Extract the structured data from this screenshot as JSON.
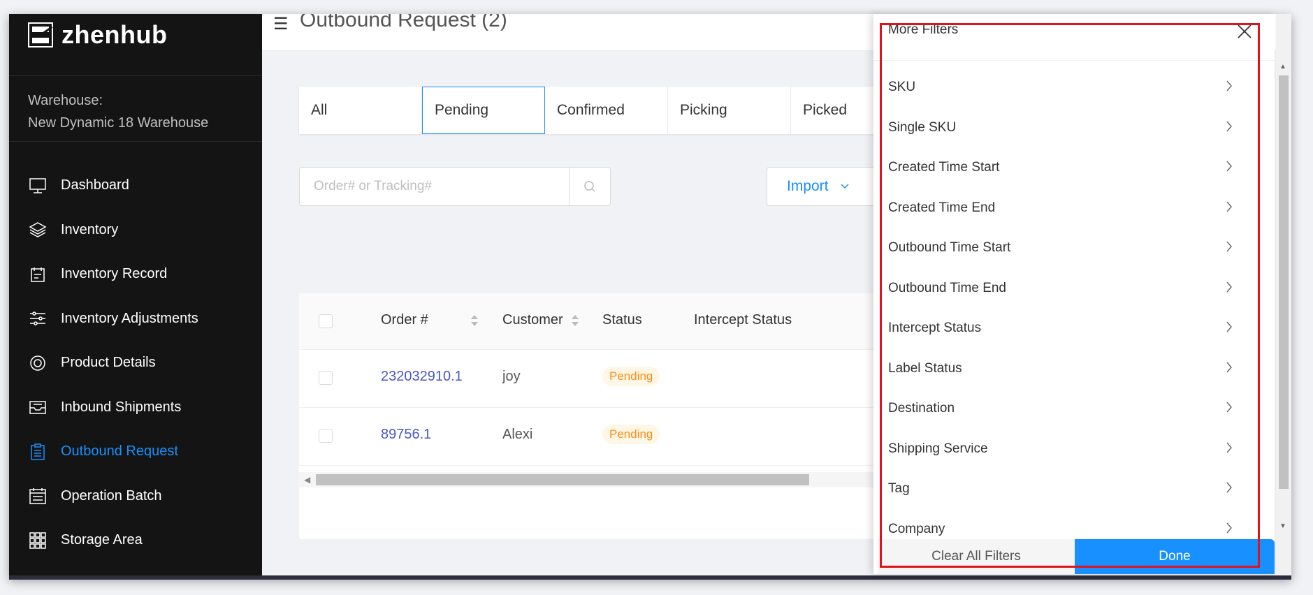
{
  "brand": {
    "name": "zhenhub"
  },
  "warehouse": {
    "label": "Warehouse:",
    "value": "New Dynamic 18 Warehouse"
  },
  "nav": [
    {
      "label": "Dashboard",
      "icon": "monitor-icon"
    },
    {
      "label": "Inventory",
      "icon": "layers-icon"
    },
    {
      "label": "Inventory Record",
      "icon": "record-icon"
    },
    {
      "label": "Inventory Adjustments",
      "icon": "sliders-icon"
    },
    {
      "label": "Product Details",
      "icon": "product-icon"
    },
    {
      "label": "Inbound Shipments",
      "icon": "inbox-icon"
    },
    {
      "label": "Outbound Request",
      "icon": "clipboard-icon",
      "active": true
    },
    {
      "label": "Operation Batch",
      "icon": "calendar-icon"
    },
    {
      "label": "Storage Area",
      "icon": "grid-icon"
    }
  ],
  "page": {
    "title": "Outbound Request (2)"
  },
  "tabs": [
    "All",
    "Pending",
    "Confirmed",
    "Picking",
    "Picked"
  ],
  "search": {
    "placeholder": "Order# or Tracking#"
  },
  "import_label": "Import",
  "table": {
    "headers": [
      "Order #",
      "Customer",
      "Status",
      "Intercept Status"
    ],
    "rows": [
      {
        "order": "232032910.1",
        "customer": "joy",
        "status": "Pending"
      },
      {
        "order": "89756.1",
        "customer": "Alexi",
        "status": "Pending"
      }
    ]
  },
  "drawer": {
    "title": "More Filters",
    "filters": [
      "SKU",
      "Single SKU",
      "Created Time Start",
      "Created Time End",
      "Outbound Time Start",
      "Outbound Time End",
      "Intercept Status",
      "Label Status",
      "Destination",
      "Shipping Service",
      "Tag",
      "Company"
    ],
    "clear_label": "Clear All Filters",
    "done_label": "Done"
  },
  "colors": {
    "accent": "#1890ff",
    "sidebar_bg": "#141414",
    "pending": "#fa8c16",
    "highlight": "#e0121c"
  }
}
